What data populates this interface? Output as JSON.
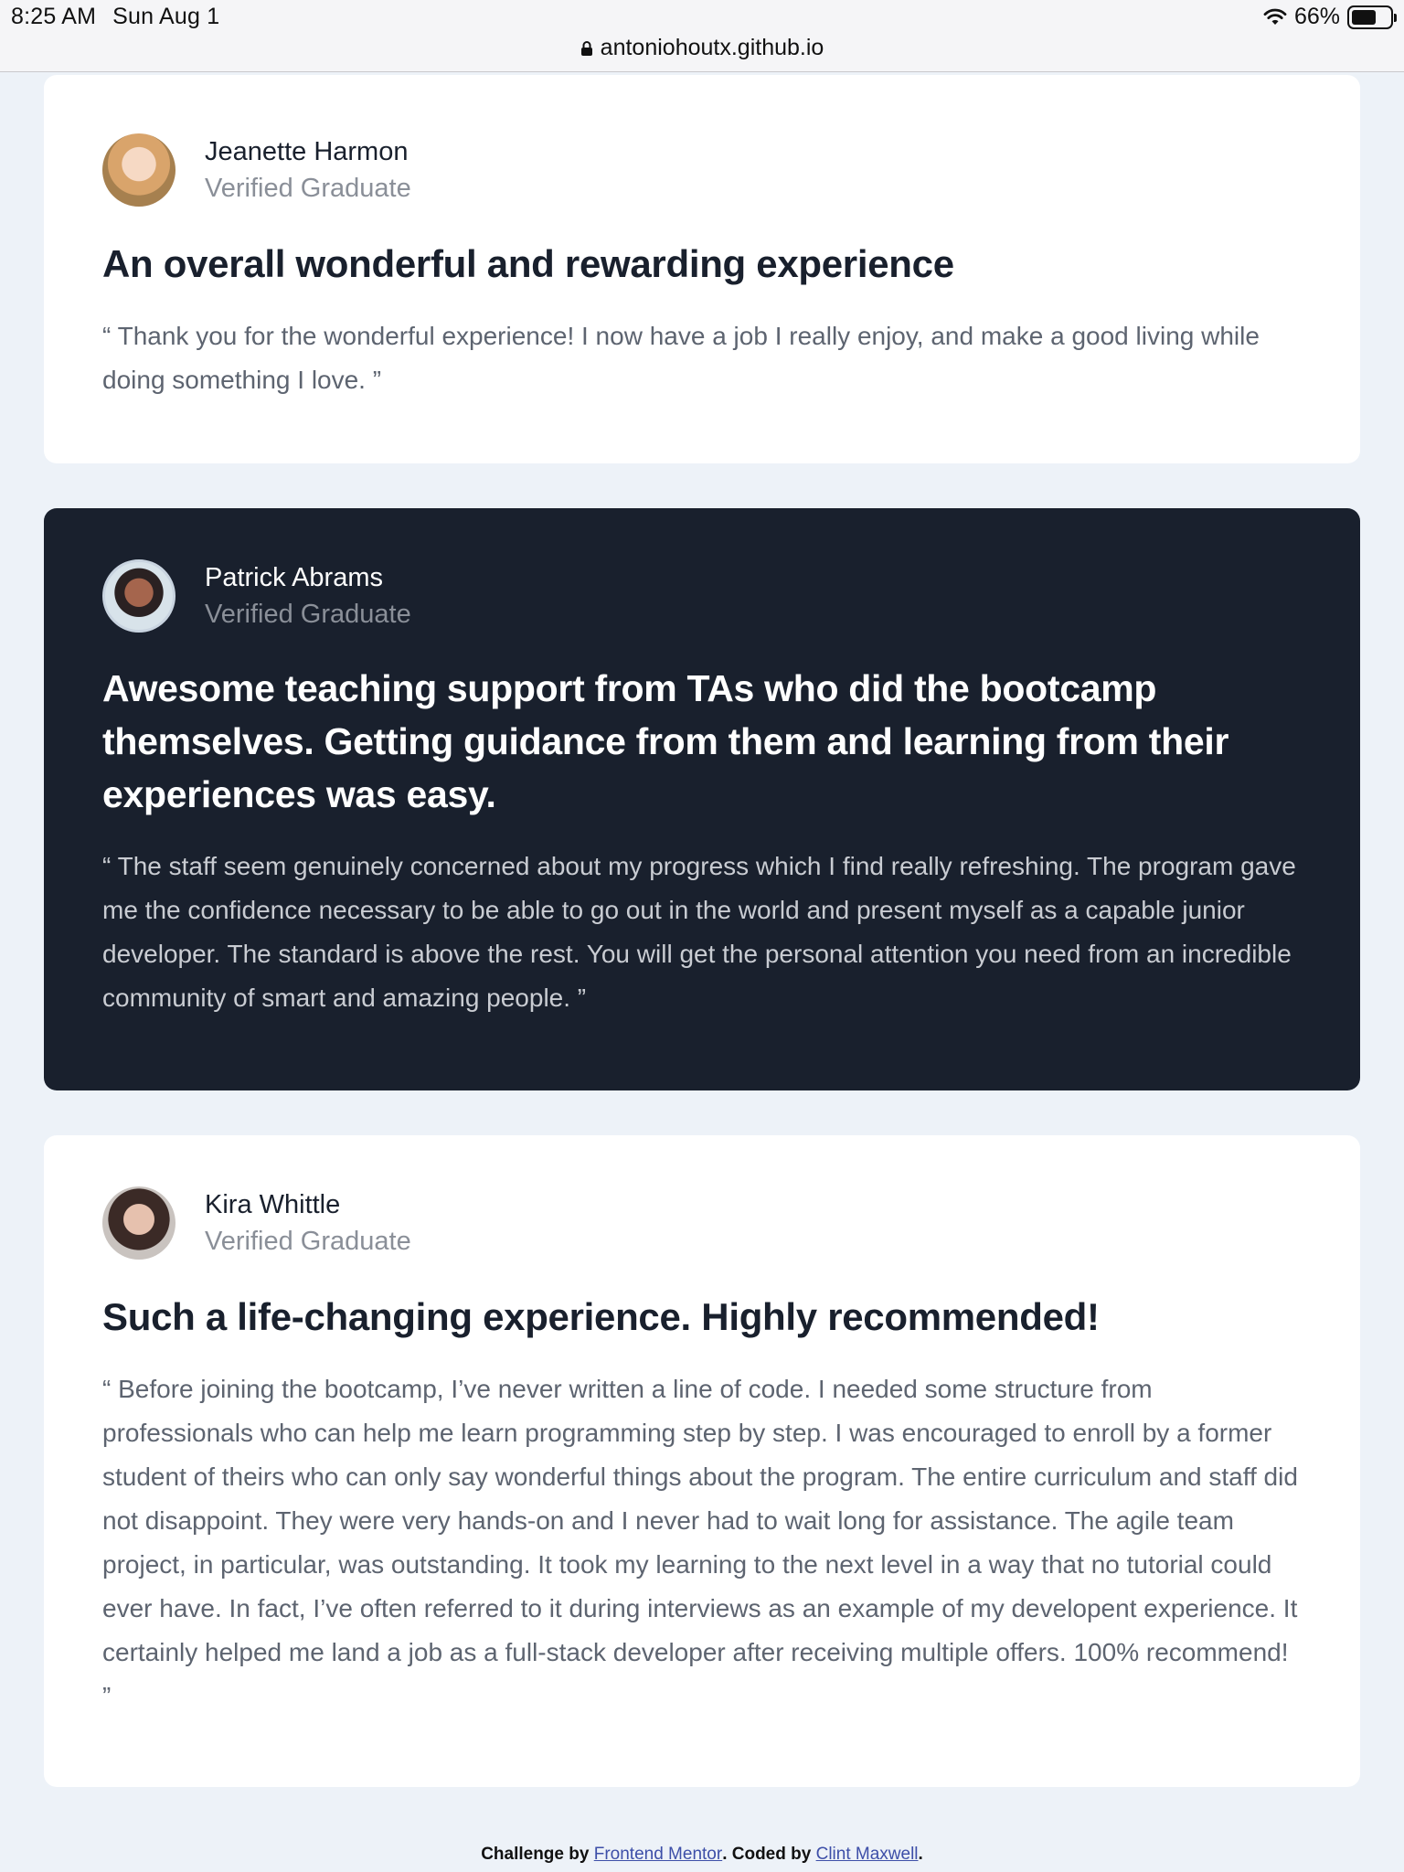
{
  "status_bar": {
    "time": "8:25 AM",
    "date": "Sun Aug 1",
    "battery": "66%",
    "battery_level": 0.66,
    "url": "antoniohoutx.github.io"
  },
  "testimonials": [
    {
      "name": "Jeanette Harmon",
      "status": "Verified Graduate",
      "headline": "An overall wonderful and rewarding experience",
      "quote": "“ Thank you for the wonderful experience! I now have a job I really enjoy, and make a good living while doing something I love. ”"
    },
    {
      "name": "Patrick Abrams",
      "status": "Verified Graduate",
      "headline": "Awesome teaching support from TAs who did the bootcamp themselves. Getting guidance from them and learning from their experiences was easy.",
      "quote": "“ The staff seem genuinely concerned about my progress which I find really refreshing. The program gave me the confidence necessary to be able to go out in the world and present myself as a capable junior developer. The standard is above the rest. You will get the personal attention you need from an incredible community of smart and amazing people. ”"
    },
    {
      "name": "Kira Whittle",
      "status": "Verified Graduate",
      "headline": "Such a life-changing experience. Highly recommended!",
      "quote": "“ Before joining the bootcamp, I’ve never written a line of code. I needed some structure from professionals who can help me learn programming step by step. I was encouraged to enroll by a former student of theirs who can only say wonderful things about the program. The entire curriculum and staff did not disappoint. They were very hands-on and I never had to wait long for assistance. The agile team project, in particular, was outstanding. It took my learning to the next level in a way that no tutorial could ever have. In fact, I’ve often referred to it during interviews as an example of my developent experience. It certainly helped me land a job as a full-stack developer after receiving multiple offers. 100% recommend! ”"
    }
  ],
  "footer": {
    "prefix": "Challenge by",
    "link1": "Frontend Mentor",
    "middle": ". Coded by",
    "link2": "Clint Maxwell",
    "suffix": "."
  },
  "colors": {
    "page_bg": "#edf2f8",
    "dark_card": "#19202d",
    "light_card": "#ffffff",
    "muted_text": "#8a8f98"
  }
}
